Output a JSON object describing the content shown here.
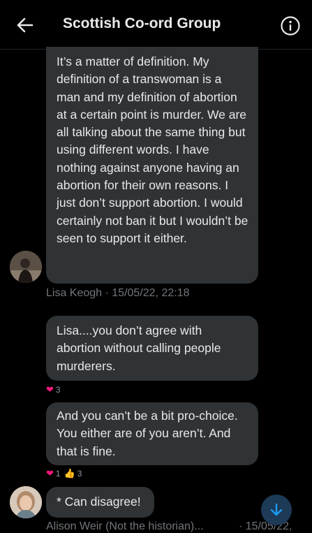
{
  "header": {
    "title": "Scottish Co-ord Group",
    "back_icon": "arrow-left-icon",
    "info_icon": "info-icon"
  },
  "messages": [
    {
      "text": "It’s a matter of definition. My definition of a transwoman is a man and my definition of abortion at a certain point is murder. We are all talking about the same thing but using different words. I have nothing against anyone having an abortion for their own reasons. I just don’t support abortion. I would certainly not ban it but I wouldn’t be seen to support it either.",
      "meta": "Lisa Keogh · 15/05/22, 22:18"
    },
    {
      "text": "Lisa....you don’t agree with abortion without calling people murderers.",
      "reactions": {
        "heart": "3"
      }
    },
    {
      "text": "And you can’t be a bit pro-choice. You either are of you aren’t. And that is fine.",
      "reactions": {
        "heart": "1",
        "thumbs": "3"
      }
    },
    {
      "text": "* Can disagree!",
      "meta_name": "Alison Weir (Not the historian)...",
      "meta_time": "· 15/05/22,"
    }
  ],
  "colors": {
    "background": "#000000",
    "bubble": "#2f3336",
    "text": "#e7e9ea",
    "muted": "#71767b",
    "heart": "#f91880",
    "accent": "#1d9bf0"
  }
}
